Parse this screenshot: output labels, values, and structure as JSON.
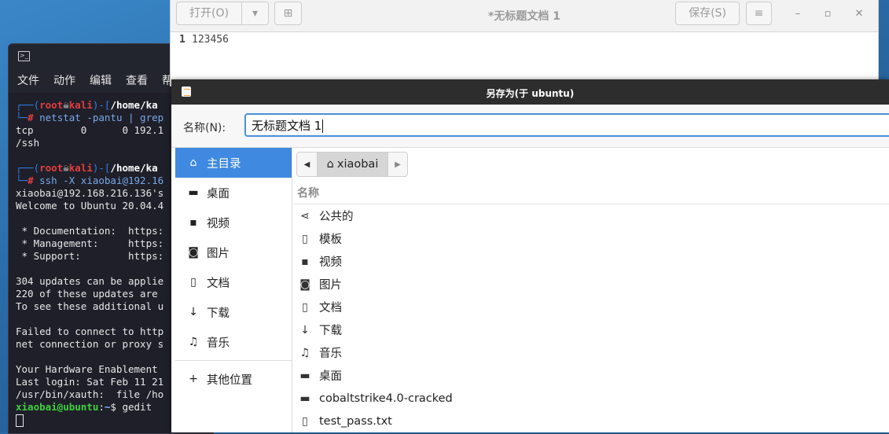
{
  "terminal": {
    "menu": [
      "文件",
      "动作",
      "编辑",
      "查看",
      "帮"
    ],
    "lines": [
      {
        "type": "prompt_top",
        "user": "root",
        "host": "kali",
        "path": "/home/ka"
      },
      {
        "type": "prompt_cmd",
        "cmd": "netstat -pantu | grep"
      },
      {
        "type": "text",
        "text": "tcp        0      0 192.1"
      },
      {
        "type": "text",
        "text": "/ssh"
      },
      {
        "type": "blank"
      },
      {
        "type": "prompt_top",
        "user": "root",
        "host": "kali",
        "path": "/home/ka"
      },
      {
        "type": "prompt_cmd",
        "cmd": "ssh -X xiaobai@192.16"
      },
      {
        "type": "text",
        "text": "xiaobai@192.168.216.136's"
      },
      {
        "type": "text",
        "text": "Welcome to Ubuntu 20.04.4"
      },
      {
        "type": "blank"
      },
      {
        "type": "text",
        "text": " * Documentation:  https:"
      },
      {
        "type": "text",
        "text": " * Management:     https:"
      },
      {
        "type": "text",
        "text": " * Support:        https:"
      },
      {
        "type": "blank"
      },
      {
        "type": "text",
        "text": "304 updates can be applie"
      },
      {
        "type": "text",
        "text": "220 of these updates are"
      },
      {
        "type": "text",
        "text": "To see these additional u"
      },
      {
        "type": "blank"
      },
      {
        "type": "text",
        "text": "Failed to connect to http"
      },
      {
        "type": "text",
        "text": "net connection or proxy s"
      },
      {
        "type": "blank"
      },
      {
        "type": "text",
        "text": "Your Hardware Enablement"
      },
      {
        "type": "text",
        "text": "Last login: Sat Feb 11 21"
      },
      {
        "type": "text",
        "text": "/usr/bin/xauth:  file /ho"
      },
      {
        "type": "shell",
        "userhost": "xiaobai@ubuntu",
        "path": "~",
        "cmd": "gedit"
      },
      {
        "type": "cursor"
      }
    ]
  },
  "gedit": {
    "title": "*无标题文档 1",
    "open_label": "打开(O)",
    "save_label": "保存(S)",
    "line_number": "1",
    "content": "123456"
  },
  "dialog": {
    "title": "另存为(于 ubuntu)",
    "name_label": "名称(N):",
    "name_value": "无标题文档 1",
    "places": [
      {
        "icon": "home-icon",
        "glyph": "⌂",
        "label": "主目录",
        "active": true
      },
      {
        "icon": "folder-icon",
        "glyph": "▬",
        "label": "桌面"
      },
      {
        "icon": "video-icon",
        "glyph": "▪",
        "label": "视频"
      },
      {
        "icon": "camera-icon",
        "glyph": "◙",
        "label": "图片"
      },
      {
        "icon": "document-icon",
        "glyph": "▯",
        "label": "文档"
      },
      {
        "icon": "download-icon",
        "glyph": "↓",
        "label": "下载"
      },
      {
        "icon": "music-icon",
        "glyph": "♫",
        "label": "音乐"
      }
    ],
    "other_places": {
      "icon": "plus-icon",
      "glyph": "+",
      "label": "其他位置"
    },
    "pathbar": {
      "home_label": "xiaobai"
    },
    "column_header": "名称",
    "files": [
      {
        "icon": "share-icon",
        "glyph": "⋖",
        "name": "公共的"
      },
      {
        "icon": "template-icon",
        "glyph": "▯",
        "name": "模板"
      },
      {
        "icon": "video-icon",
        "glyph": "▪",
        "name": "视频"
      },
      {
        "icon": "camera-icon",
        "glyph": "◙",
        "name": "图片"
      },
      {
        "icon": "document-icon",
        "glyph": "▯",
        "name": "文档"
      },
      {
        "icon": "download-icon",
        "glyph": "↓",
        "name": "下载"
      },
      {
        "icon": "music-icon",
        "glyph": "♫",
        "name": "音乐"
      },
      {
        "icon": "folder-icon",
        "glyph": "▬",
        "name": "桌面"
      },
      {
        "icon": "folder-icon",
        "glyph": "▬",
        "name": "cobaltstrike4.0-cracked"
      },
      {
        "icon": "document-icon",
        "glyph": "▯",
        "name": "test_pass.txt"
      }
    ]
  }
}
